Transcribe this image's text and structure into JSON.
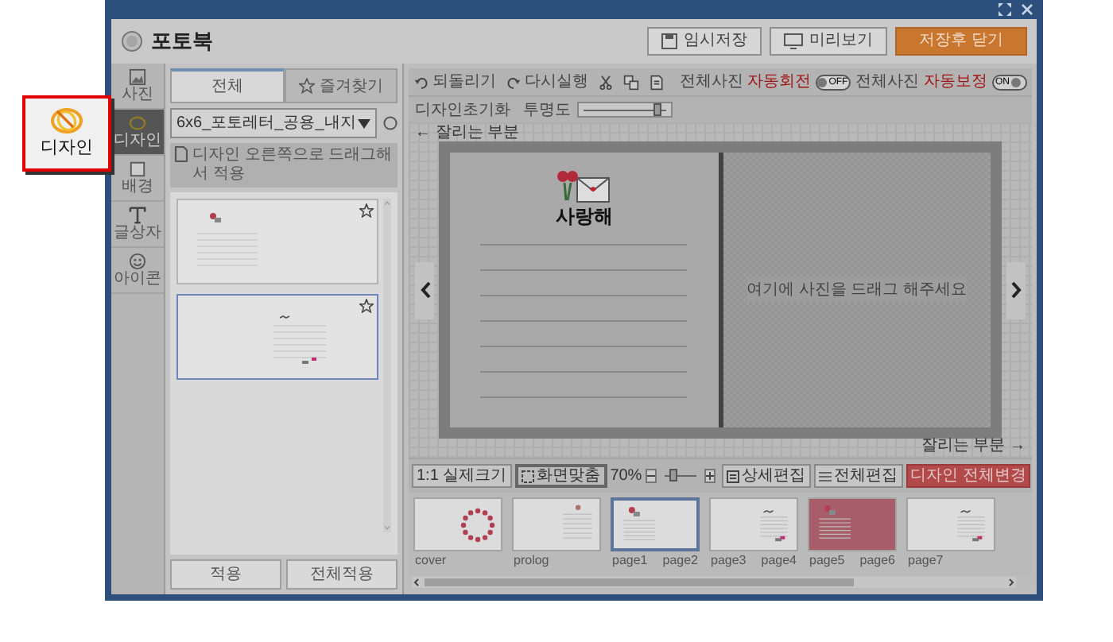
{
  "window": {
    "title": "포토북"
  },
  "header_buttons": [
    {
      "label": "임시저장",
      "kind": "save"
    },
    {
      "label": "미리보기",
      "kind": "preview"
    },
    {
      "label": "저장후 닫기",
      "kind": "primary"
    }
  ],
  "callout": {
    "label": "디자인"
  },
  "nav": [
    {
      "label": "사진",
      "kind": "photo",
      "selected": false
    },
    {
      "label": "디자인",
      "kind": "design",
      "selected": true
    },
    {
      "label": "배경",
      "kind": "background",
      "selected": false
    },
    {
      "label": "글상자",
      "kind": "text",
      "selected": false
    },
    {
      "label": "아이콘",
      "kind": "emoji",
      "selected": false
    }
  ],
  "panel": {
    "tabs": [
      {
        "label": "전체",
        "selected": true
      },
      {
        "label": "즐겨찾기",
        "selected": false
      }
    ],
    "dropdown": {
      "value": "6x6_포토레터_공용_내지"
    },
    "hint": "디자인 오른쪽으로 드래그해서 적용",
    "designs": [
      {
        "kind": "sticker_left",
        "selected": false
      },
      {
        "kind": "sticker_right",
        "selected": true
      }
    ],
    "buttons": [
      "적용",
      "전체적용"
    ]
  },
  "toolbar": {
    "actions": [
      {
        "label": "되돌리기",
        "kind": "undo"
      },
      {
        "label": "다시실행",
        "kind": "redo"
      },
      {
        "kind": "cut"
      },
      {
        "kind": "copy"
      },
      {
        "kind": "paste"
      }
    ],
    "toggles": [
      {
        "prefix": "전체사진",
        "label": "자동회전",
        "state_label": "OFF",
        "on": false
      },
      {
        "prefix": "전체사진",
        "label": "자동보정",
        "state_label": "ON",
        "on": true
      }
    ],
    "design_reset": "디자인초기화",
    "opacity": {
      "label": "투명도",
      "level": 0.85
    }
  },
  "canvas": {
    "crop_top": "← 잘리는 부분",
    "crop_bottom": "잘리는 부분 →",
    "sticker_text": "사랑해",
    "drop_hint": "여기에 사진을 드래그 해주세요"
  },
  "view_bar": {
    "modes": [
      {
        "label": "1:1 실제크기",
        "kind": "actual",
        "selected": false
      },
      {
        "label": "화면맞춤",
        "kind": "fit",
        "selected": true
      }
    ],
    "zoom": {
      "reading": "70%",
      "level": 0.3
    },
    "buttons": [
      {
        "label": "상세편집",
        "kind": "detail"
      },
      {
        "label": "전체편집",
        "kind": "all"
      },
      {
        "label": "디자인 전체변경",
        "kind": "primary"
      }
    ]
  },
  "pages": [
    {
      "labels": [
        "cover"
      ],
      "kind": "wreath",
      "color": "#dcdcdc",
      "selected": false
    },
    {
      "labels": [
        "prolog"
      ],
      "kind": "lines_right",
      "color": "#dcdcdc",
      "selected": false
    },
    {
      "labels": [
        "page1",
        "page2"
      ],
      "kind": "sticker_left",
      "color": "#dcdcdc",
      "selected": true
    },
    {
      "labels": [
        "page3",
        "page4"
      ],
      "kind": "sticker_right",
      "color": "#dcdcdc",
      "selected": false
    },
    {
      "labels": [
        "page5",
        "page6"
      ],
      "kind": "sticker_left",
      "color": "#a85d6a",
      "selected": false
    },
    {
      "labels": [
        "page7"
      ],
      "kind": "sticker_right",
      "color": "#dcdcdc",
      "selected": false
    }
  ]
}
